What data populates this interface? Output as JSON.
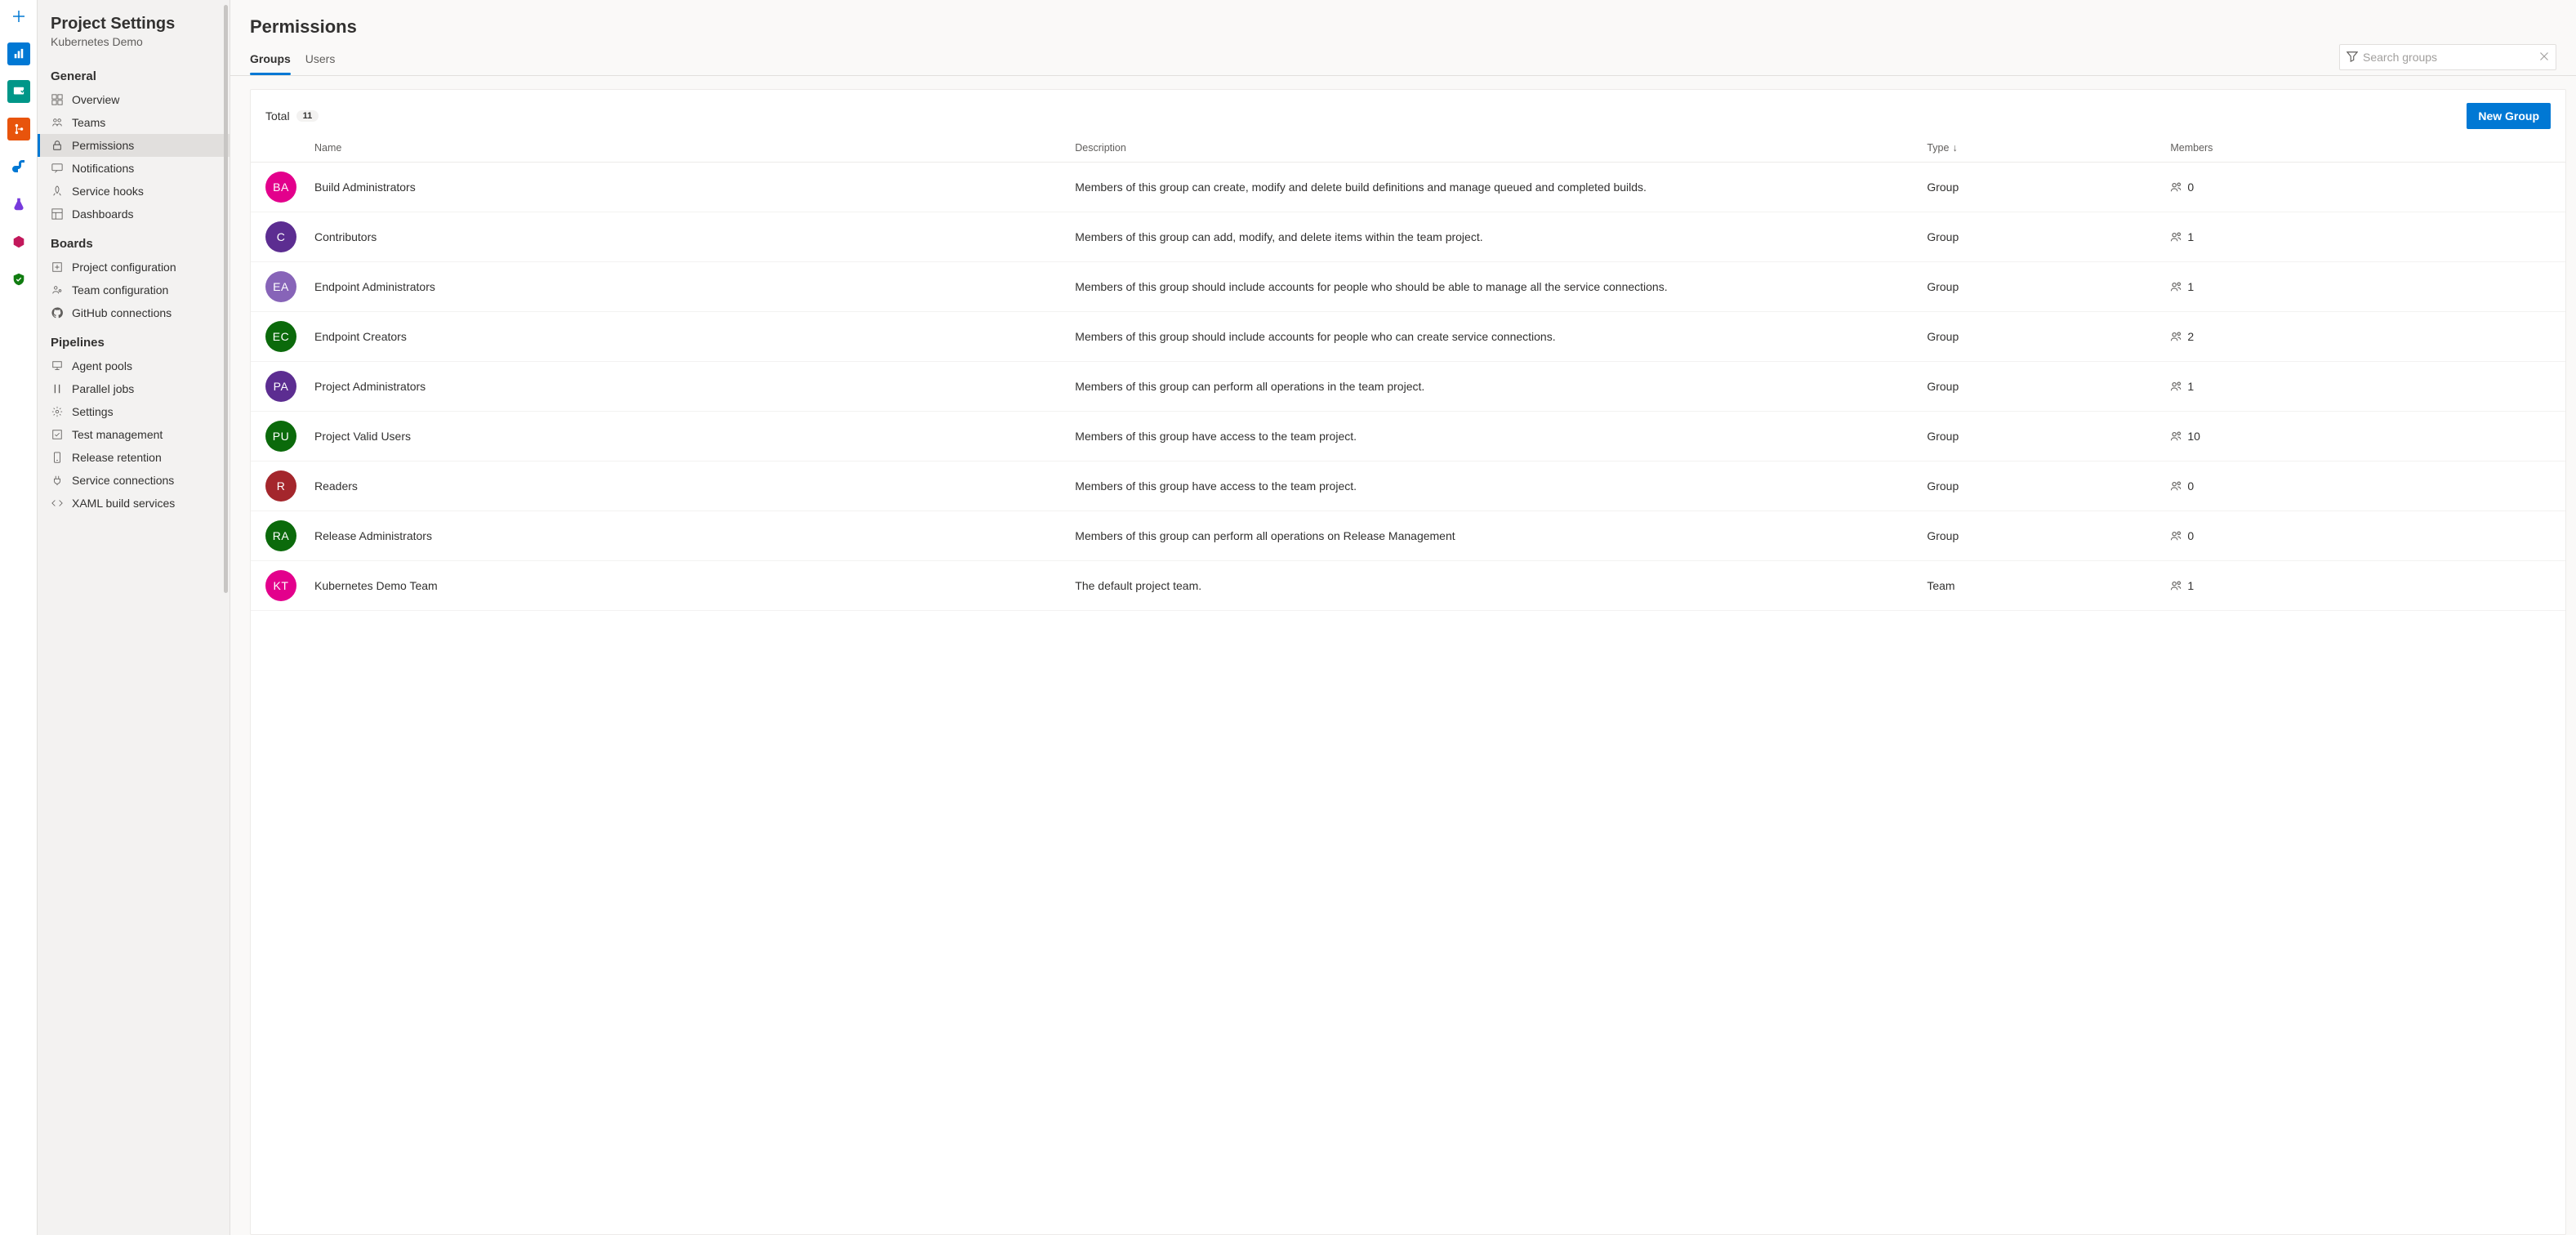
{
  "sidebar": {
    "title": "Project Settings",
    "subtitle": "Kubernetes Demo",
    "sections": {
      "general": "General",
      "boards": "Boards",
      "pipelines": "Pipelines"
    },
    "items": {
      "overview": "Overview",
      "teams": "Teams",
      "permissions": "Permissions",
      "notifications": "Notifications",
      "service_hooks": "Service hooks",
      "dashboards": "Dashboards",
      "project_configuration": "Project configuration",
      "team_configuration": "Team configuration",
      "github_connections": "GitHub connections",
      "agent_pools": "Agent pools",
      "parallel_jobs": "Parallel jobs",
      "settings": "Settings",
      "test_management": "Test management",
      "release_retention": "Release retention",
      "service_connections": "Service connections",
      "xaml_build_services": "XAML build services"
    }
  },
  "header": {
    "title": "Permissions",
    "tabs": {
      "groups": "Groups",
      "users": "Users"
    },
    "search_placeholder": "Search groups"
  },
  "card": {
    "total_label": "Total",
    "total_count": "11",
    "new_button": "New Group",
    "columns": {
      "name": "Name",
      "description": "Description",
      "type": "Type",
      "members": "Members"
    }
  },
  "groups": [
    {
      "initials": "BA",
      "color": "#e3008c",
      "name": "Build Administrators",
      "description": "Members of this group can create, modify and delete build definitions and manage queued and completed builds.",
      "type": "Group",
      "members": "0"
    },
    {
      "initials": "C",
      "color": "#5c2d91",
      "name": "Contributors",
      "description": "Members of this group can add, modify, and delete items within the team project.",
      "type": "Group",
      "members": "1"
    },
    {
      "initials": "EA",
      "color": "#8764b8",
      "name": "Endpoint Administrators",
      "description": "Members of this group should include accounts for people who should be able to manage all the service connections.",
      "type": "Group",
      "members": "1"
    },
    {
      "initials": "EC",
      "color": "#0b6a0b",
      "name": "Endpoint Creators",
      "description": "Members of this group should include accounts for people who can create service connections.",
      "type": "Group",
      "members": "2"
    },
    {
      "initials": "PA",
      "color": "#5c2d91",
      "name": "Project Administrators",
      "description": "Members of this group can perform all operations in the team project.",
      "type": "Group",
      "members": "1"
    },
    {
      "initials": "PU",
      "color": "#0b6a0b",
      "name": "Project Valid Users",
      "description": "Members of this group have access to the team project.",
      "type": "Group",
      "members": "10"
    },
    {
      "initials": "R",
      "color": "#a4262c",
      "name": "Readers",
      "description": "Members of this group have access to the team project.",
      "type": "Group",
      "members": "0"
    },
    {
      "initials": "RA",
      "color": "#0b6a0b",
      "name": "Release Administrators",
      "description": "Members of this group can perform all operations on Release Management",
      "type": "Group",
      "members": "0"
    },
    {
      "initials": "KT",
      "color": "#e3008c",
      "name": "Kubernetes Demo Team",
      "description": "The default project team.",
      "type": "Team",
      "members": "1"
    }
  ]
}
